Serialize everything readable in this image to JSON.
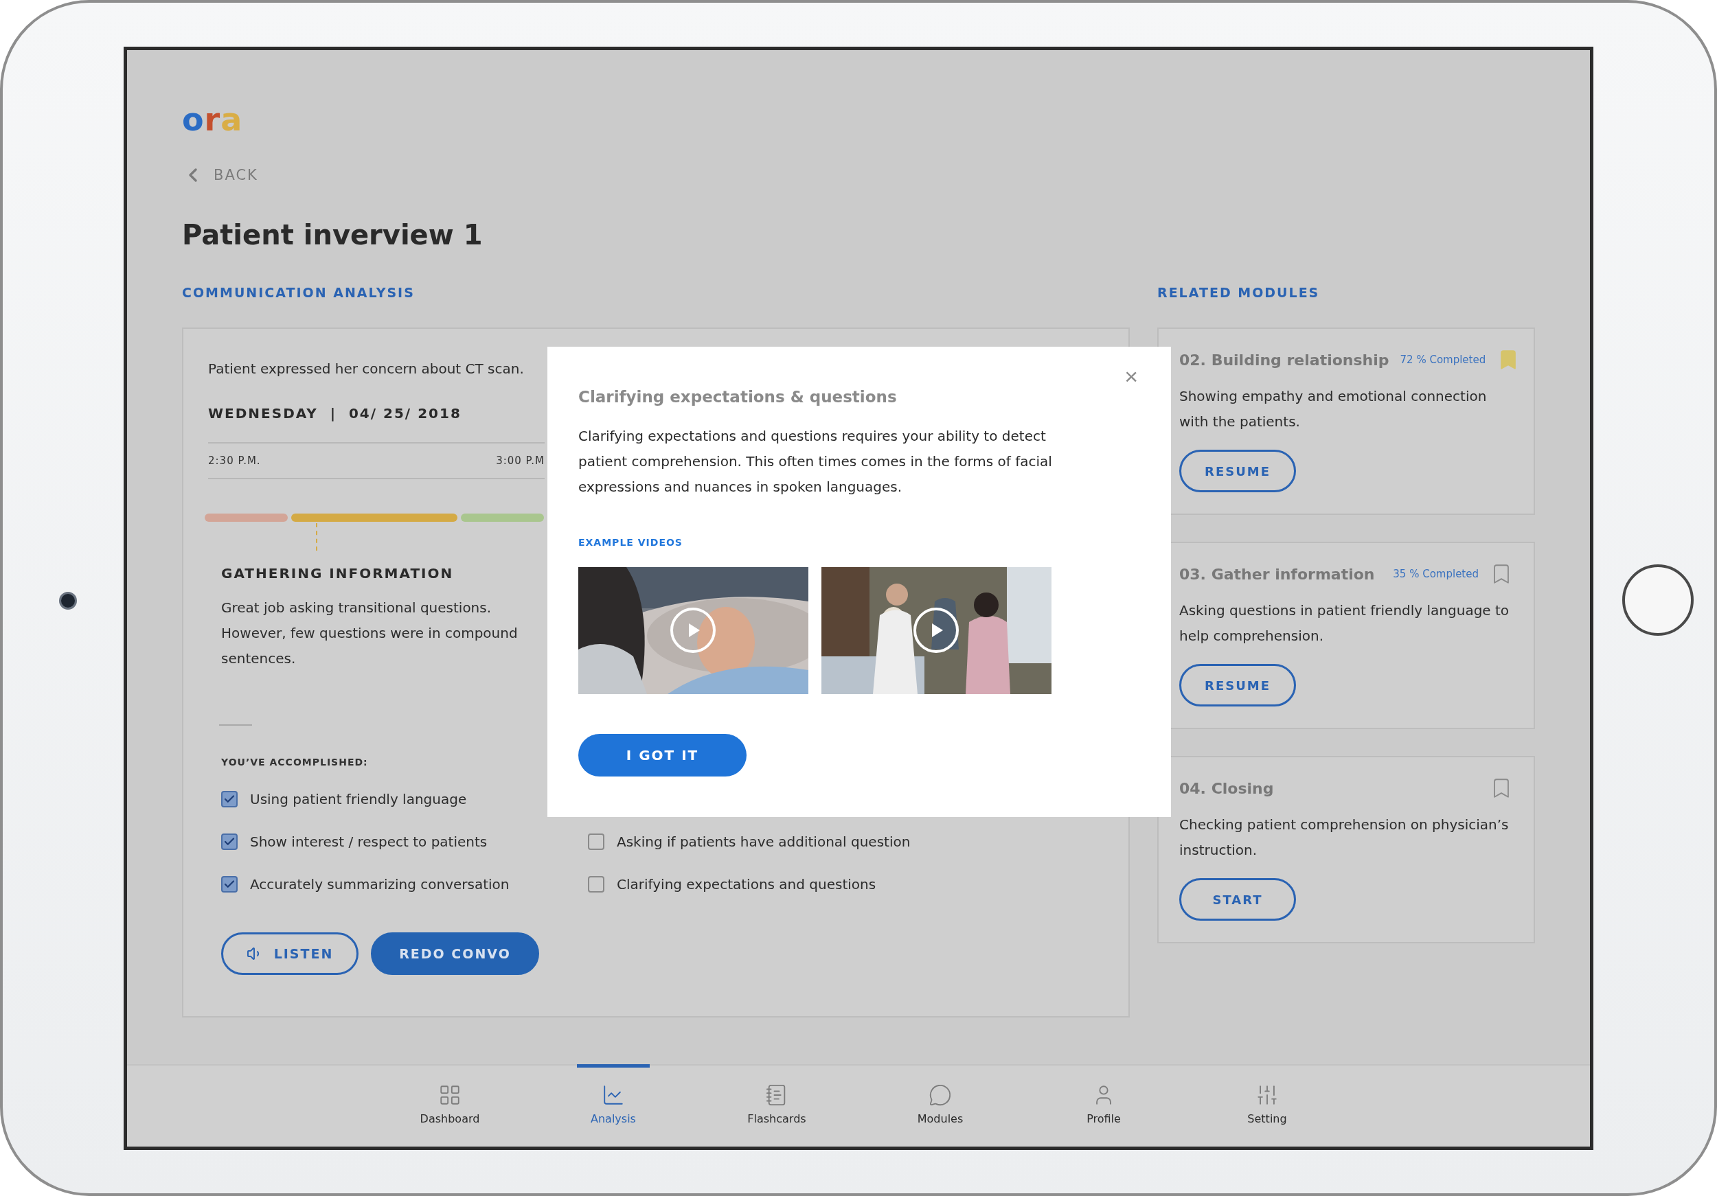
{
  "logo": [
    {
      "char": "o",
      "color": "#2b6cc4"
    },
    {
      "char": "r",
      "color": "#c4502e"
    },
    {
      "char": "a",
      "color": "#d9ad45"
    }
  ],
  "back": {
    "label": "BACK"
  },
  "title": "Patient inverview 1",
  "analysis": {
    "heading": "COMMUNICATION ANALYSIS",
    "summary": "Patient expressed her concern about CT scan.",
    "date": "WEDNESDAY  |  04/ 25/ 2018",
    "times": [
      "2:30 P.M.",
      "3:00 P.M"
    ],
    "timeline": [
      {
        "color": "#d3a597"
      },
      {
        "color": "#d4aa45"
      },
      {
        "color": "#a9c68e"
      }
    ],
    "section_title": "GATHERING INFORMATION",
    "section_text": "Great job asking transitional questions. However, few questions were in compound sentences.",
    "accomplished_label": "YOU’VE ACCOMPLISHED:",
    "checklist_left": [
      {
        "label": "Using patient friendly language",
        "checked": true
      },
      {
        "label": "Show interest / respect to patients",
        "checked": true
      },
      {
        "label": "Accurately summarizing conversation",
        "checked": true
      }
    ],
    "checklist_right": [
      {
        "label": "Asking if patients have additional question",
        "checked": false
      },
      {
        "label": "Clarifying expectations and questions",
        "checked": false
      }
    ],
    "buttons": [
      {
        "label": "LISTEN",
        "kind": "outline"
      },
      {
        "label": "REDO CONVO",
        "kind": "filled"
      }
    ]
  },
  "related": {
    "heading": "RELATED MODULES",
    "modules": [
      {
        "title": "02. Building relationship",
        "progress": "72 % Completed",
        "bookmarked": true,
        "description": "Showing empathy and emotional connection with the patients.",
        "action": "RESUME"
      },
      {
        "title": "03. Gather information",
        "progress": "35 % Completed",
        "bookmarked": false,
        "description": "Asking questions in patient friendly language to help comprehension.",
        "action": "RESUME"
      },
      {
        "title": "04. Closing",
        "bookmarked": false,
        "description": "Checking patient comprehension on physician’s instruction.",
        "action": "START"
      }
    ]
  },
  "modal": {
    "title": "Clarifying expectations & questions",
    "close": "×",
    "body": "Clarifying expectations and questions requires your ability to detect patient comprehension. This often times comes in the forms of facial expressions and nuances in spoken languages.",
    "videos_label": "EXAMPLE VIDEOS",
    "button": "I GOT IT"
  },
  "nav": [
    {
      "label": "Dashboard",
      "selected": false
    },
    {
      "label": "Analysis",
      "selected": true
    },
    {
      "label": "Flashcards",
      "selected": false
    },
    {
      "label": "Modules",
      "selected": false
    },
    {
      "label": "Profile",
      "selected": false
    },
    {
      "label": "Setting",
      "selected": false
    }
  ]
}
